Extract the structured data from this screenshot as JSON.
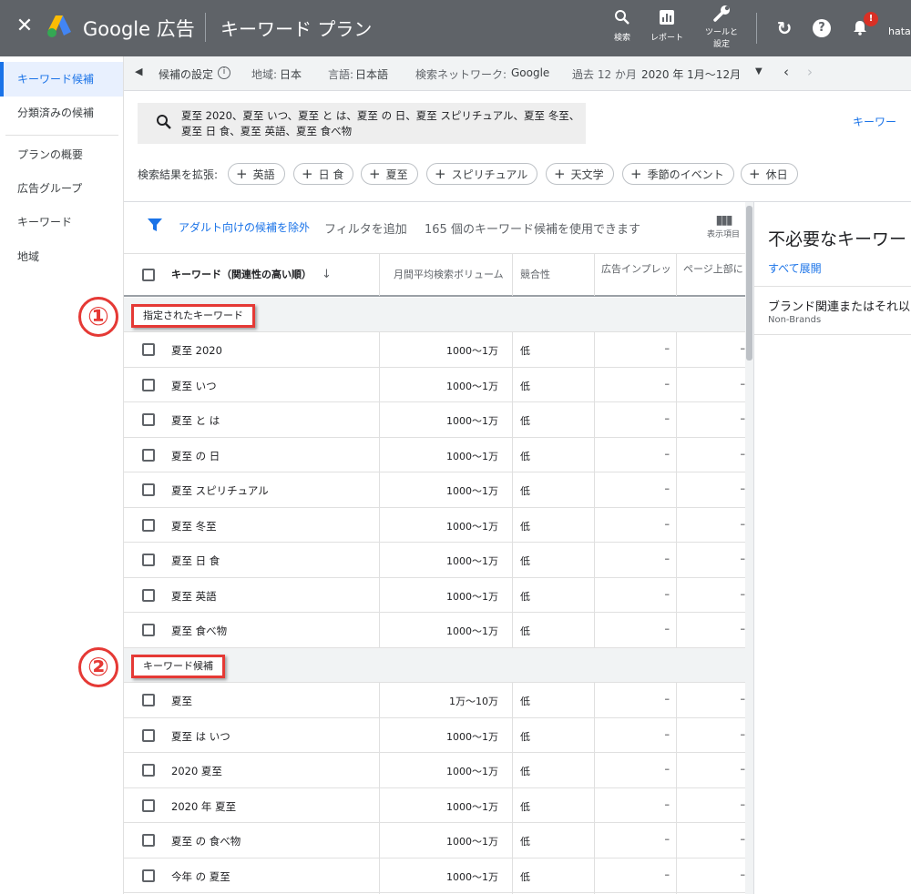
{
  "topbar": {
    "close": "✕",
    "brand": "Google 広告",
    "title": "キーワード プラン",
    "search_label": "検索",
    "report_label": "レポート",
    "tools_label_1": "ツールと",
    "tools_label_2": "設定",
    "notification_count": "!",
    "user": "hatan"
  },
  "sidenav": {
    "items": [
      {
        "label": "キーワード候補"
      },
      {
        "label": "分類済みの候補"
      },
      {
        "label": "プランの概要"
      },
      {
        "label": "広告グループ"
      },
      {
        "label": "キーワード"
      },
      {
        "label": "地域"
      }
    ]
  },
  "settings": {
    "candidate_settings": "候補の設定",
    "region_label": "地域:",
    "region_value": "日本",
    "language_label": "言語:",
    "language_value": "日本語",
    "network_label": "検索ネットワーク:",
    "network_value": "Google",
    "period_label": "過去 12 か月",
    "period_value": "2020 年 1月〜12月"
  },
  "search": {
    "query": "夏至 2020、夏至 いつ、夏至 と は、夏至 の 日、夏至 スピリチュアル、夏至 冬至、夏至 日 食、夏至 英語、夏至 食べ物",
    "keyword_link": "キーワー",
    "expand_label": "検索結果を拡張:",
    "chips": [
      "英語",
      "日 食",
      "夏至",
      "スピリチュアル",
      "天文学",
      "季節のイベント",
      "休日"
    ]
  },
  "toolbar": {
    "exclude_adult": "アダルト向けの候補を除外",
    "add_filter": "フィルタを追加",
    "count_text": "165 個のキーワード候補を使用できます",
    "columns_label": "表示項目"
  },
  "table": {
    "headers": {
      "keyword": "キーワード（関連性の高い順）",
      "volume": "月間平均検索ボリューム",
      "competition": "競合性",
      "impression": "広告インプレッ",
      "top": "ページ上部に"
    },
    "group1": {
      "label": "指定されたキーワード",
      "rows": [
        {
          "kw": "夏至 2020",
          "vol": "1000〜1万",
          "comp": "低",
          "imp": "–",
          "top": "–"
        },
        {
          "kw": "夏至 いつ",
          "vol": "1000〜1万",
          "comp": "低",
          "imp": "–",
          "top": "–"
        },
        {
          "kw": "夏至 と は",
          "vol": "1000〜1万",
          "comp": "低",
          "imp": "–",
          "top": "–"
        },
        {
          "kw": "夏至 の 日",
          "vol": "1000〜1万",
          "comp": "低",
          "imp": "–",
          "top": "–"
        },
        {
          "kw": "夏至 スピリチュアル",
          "vol": "1000〜1万",
          "comp": "低",
          "imp": "–",
          "top": "–"
        },
        {
          "kw": "夏至 冬至",
          "vol": "1000〜1万",
          "comp": "低",
          "imp": "–",
          "top": "–"
        },
        {
          "kw": "夏至 日 食",
          "vol": "1000〜1万",
          "comp": "低",
          "imp": "–",
          "top": "–"
        },
        {
          "kw": "夏至 英語",
          "vol": "1000〜1万",
          "comp": "低",
          "imp": "–",
          "top": "–"
        },
        {
          "kw": "夏至 食べ物",
          "vol": "1000〜1万",
          "comp": "低",
          "imp": "–",
          "top": "–"
        }
      ]
    },
    "group2": {
      "label": "キーワード候補",
      "rows": [
        {
          "kw": "夏至",
          "vol": "1万〜10万",
          "comp": "低",
          "imp": "–",
          "top": "–"
        },
        {
          "kw": "夏至 は いつ",
          "vol": "1000〜1万",
          "comp": "低",
          "imp": "–",
          "top": "–"
        },
        {
          "kw": "2020 夏至",
          "vol": "1000〜1万",
          "comp": "低",
          "imp": "–",
          "top": "–"
        },
        {
          "kw": "2020 年 夏至",
          "vol": "1000〜1万",
          "comp": "低",
          "imp": "–",
          "top": "–"
        },
        {
          "kw": "夏至 の 食べ物",
          "vol": "1000〜1万",
          "comp": "低",
          "imp": "–",
          "top": "–"
        },
        {
          "kw": "今年 の 夏至",
          "vol": "1000〜1万",
          "comp": "低",
          "imp": "–",
          "top": "–"
        }
      ]
    }
  },
  "rightpanel": {
    "title": "不必要なキーワード",
    "expand_all": "すべて展開",
    "brand_title": "ブランド関連またはそれ以",
    "brand_sub": "Non-Brands"
  },
  "annotations": {
    "one": "①",
    "two": "②"
  },
  "colors": {
    "topbar": "#5f6368",
    "accent": "#1a73e8",
    "annotation": "#e53935"
  }
}
